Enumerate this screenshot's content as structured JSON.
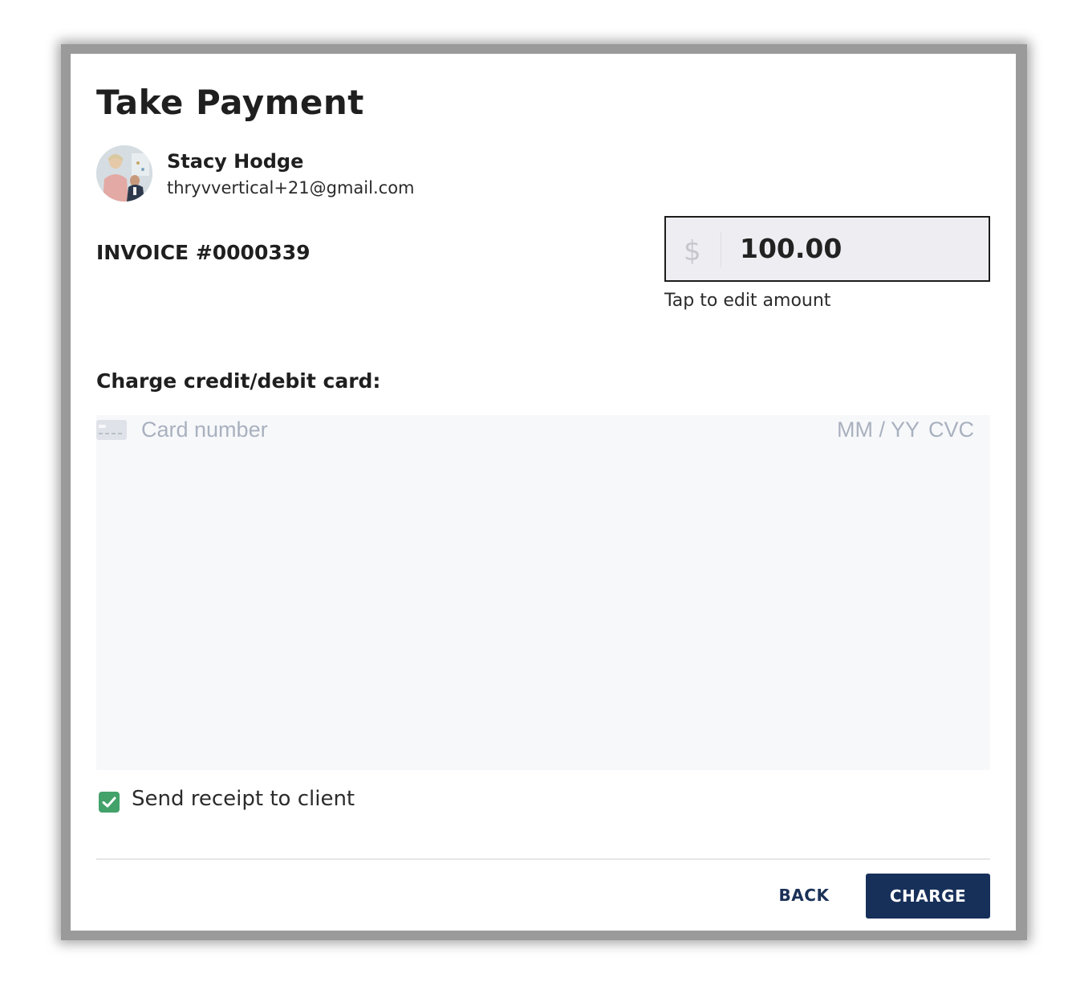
{
  "dialog": {
    "title": "Take Payment"
  },
  "client": {
    "name": "Stacy Hodge",
    "email": "thryvvertical+21@gmail.com"
  },
  "invoice": {
    "number_label": "INVOICE #0000339"
  },
  "amount": {
    "currency_symbol": "$",
    "value": "100.00",
    "hint": "Tap to edit amount"
  },
  "card": {
    "section_label": "Charge credit/debit card:",
    "icon": "credit-card-icon",
    "number_placeholder": "Card number",
    "expiry_placeholder": "MM / YY",
    "cvc_placeholder": "CVC"
  },
  "receipt": {
    "checked": true,
    "label": "Send receipt to client"
  },
  "actions": {
    "back_label": "BACK",
    "charge_label": "CHARGE"
  },
  "colors": {
    "primary": "#17305a",
    "checkbox": "#43a16a",
    "amount_background": "#eeeef2",
    "card_area_background": "#f7f8fa"
  }
}
